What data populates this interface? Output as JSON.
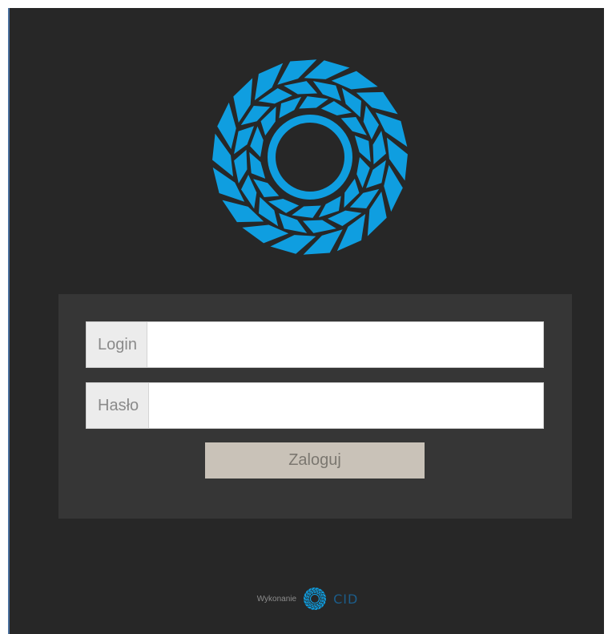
{
  "brand": {
    "logo_icon": "circular-rings-logo-icon",
    "accent_color": "#0f9ee0"
  },
  "login_form": {
    "login_label": "Login",
    "login_value": "",
    "password_label": "Hasło",
    "password_value": "",
    "submit_label": "Zaloguj"
  },
  "footer": {
    "made_by_text": "Wykonanie",
    "vendor_icon": "vendor-logo-icon",
    "vendor_name": "CID"
  },
  "colors": {
    "background": "#272727",
    "panel": "#363636",
    "button": "#c9c2b8",
    "addon": "#ececec"
  }
}
